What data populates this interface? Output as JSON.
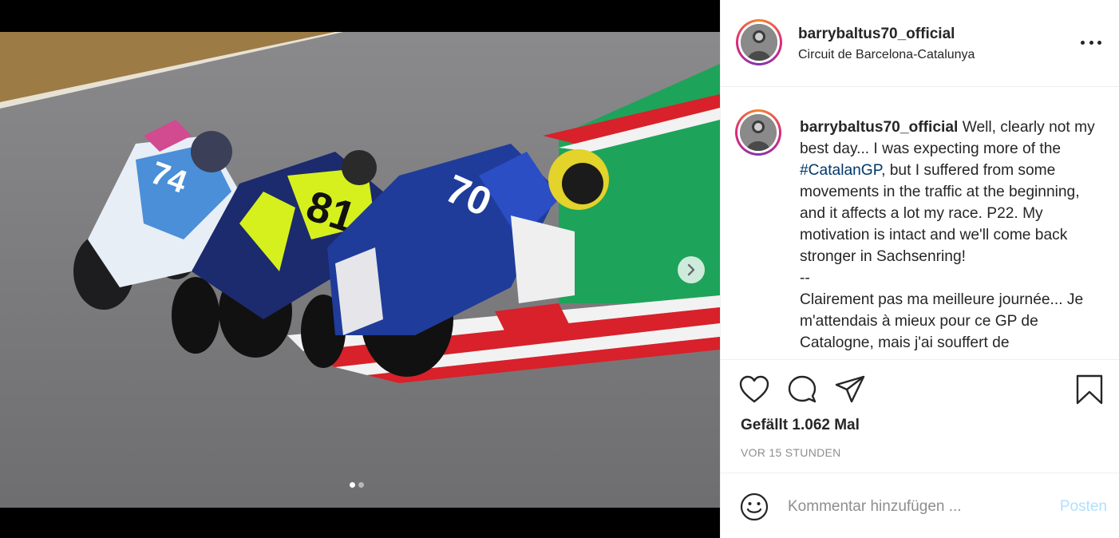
{
  "post": {
    "username": "barrybaltus70_official",
    "location": "Circuit de Barcelona-Catalunya",
    "caption_before_tag": " Well, clearly not my best day... I was expecting more of the ",
    "hashtag": "#CatalanGP",
    "caption_after_tag": ", but I suffered from some movements in the traffic at the beginning, and it affects a lot my race. P22. My motivation is intact and we'll come back stronger in Sachsenring!\n--\nClairement pas ma meilleure journée... Je m'attendais à mieux pour ce GP de Catalogne, mais j'ai souffert de",
    "likes_text": "Gefällt 1.062 Mal",
    "time_ago": "VOR 15 STUNDEN"
  },
  "media": {
    "bike_numbers": [
      "74",
      "81",
      "70"
    ],
    "carousel_count": 2,
    "carousel_active": 1
  },
  "comment_box": {
    "placeholder": "Kommentar hinzufügen ...",
    "post_label": "Posten"
  },
  "icons": {
    "more": "more-options-icon",
    "like": "heart-icon",
    "comment": "comment-bubble-icon",
    "share": "paper-plane-icon",
    "save": "bookmark-icon",
    "emoji": "emoji-smiley-icon",
    "next": "chevron-right-icon"
  },
  "colors": {
    "hashtag": "#00376b",
    "post_button_disabled": "#b2dffc",
    "secondary_text": "#8e8e8e",
    "story_ring_start": "#f58529",
    "story_ring_end": "#dd2a7b"
  }
}
